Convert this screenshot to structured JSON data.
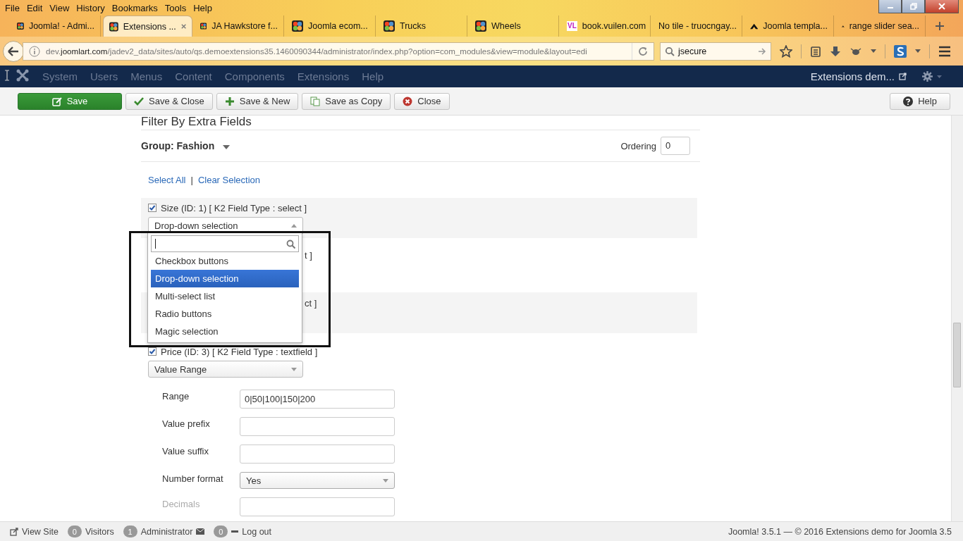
{
  "menu_bar": [
    "File",
    "Edit",
    "View",
    "History",
    "Bookmarks",
    "Tools",
    "Help"
  ],
  "browser_tabs": [
    {
      "title": "Joomla! - Admi...",
      "kind": "joomla",
      "selected": false
    },
    {
      "title": "Extensions ...",
      "kind": "joomla",
      "selected": true
    },
    {
      "title": "JA Hawkstore f...",
      "kind": "joomla",
      "selected": false
    },
    {
      "title": "Joomla ecom...",
      "kind": "joomla",
      "selected": false
    },
    {
      "title": "Trucks",
      "kind": "joomla",
      "selected": false
    },
    {
      "title": "Wheels",
      "kind": "joomla",
      "selected": false
    },
    {
      "title": "book.vuilen.com",
      "kind": "lettermark",
      "logo_text": "VL",
      "selected": false
    },
    {
      "title": "No tile - truocngay...",
      "kind": "plain",
      "selected": false
    },
    {
      "title": "Joomla templa...",
      "kind": "peak",
      "selected": false
    },
    {
      "title": "range slider sea...",
      "kind": "peak",
      "selected": false
    }
  ],
  "address_bar": {
    "url": "dev.**joomlart.com**/jadev2_data/sites/auto/qs.demoextensions35.1460090344/administrator/index.php?option=com_modules&view=module&layout=edi"
  },
  "search_box": {
    "value": "jsecure"
  },
  "admin_menu": {
    "items": [
      "System",
      "Users",
      "Menus",
      "Content",
      "Components",
      "Extensions",
      "Help"
    ],
    "site_link": "Extensions dem..."
  },
  "toolbar": {
    "buttons": [
      {
        "label": "Save",
        "kind": "primary"
      },
      {
        "label": "Save & Close",
        "kind": "default"
      },
      {
        "label": "Save & New",
        "kind": "default"
      },
      {
        "label": "Save as Copy",
        "kind": "default"
      },
      {
        "label": "Close",
        "kind": "default"
      }
    ],
    "help": "Help"
  },
  "section_title": "Filter By Extra Fields",
  "group": {
    "label": "Group: Fashion",
    "ordering_label": "Ordering",
    "ordering_value": "0"
  },
  "select_links": {
    "items": [
      "Select All",
      "Clear Selection"
    ],
    "separator": "|"
  },
  "fields": [
    {
      "kind": "field",
      "label": "Size (ID: 1) [ K2 Field Type : select ]",
      "checked": true,
      "display": "Drop-down selection",
      "expanded": true
    },
    {
      "kind": "covered",
      "label": "t ]"
    },
    {
      "kind": "covered",
      "label": "ct ]"
    },
    {
      "kind": "field",
      "label": "Price (ID: 3) [ K2 Field Type : textfield ]",
      "checked": true,
      "display": "Value Range",
      "expanded": false
    }
  ],
  "dropdown_options": [
    {
      "label": "Checkbox buttons",
      "selected": false
    },
    {
      "label": "Drop-down selection",
      "selected": true
    },
    {
      "label": "Multi-select list",
      "selected": false
    },
    {
      "label": "Radio buttons",
      "selected": false
    },
    {
      "label": "Magic selection",
      "selected": false
    }
  ],
  "price_settings": [
    {
      "label": "Range",
      "kind": "text",
      "value": "0|50|100|150|200"
    },
    {
      "label": "Value prefix",
      "kind": "text"
    },
    {
      "label": "Value suffix",
      "kind": "text"
    },
    {
      "label": "Number format",
      "kind": "select",
      "value": "Yes"
    },
    {
      "label": "Decimals",
      "kind": "text"
    }
  ],
  "status_bar": {
    "view_site": "View Site",
    "visitors_count": "0",
    "visitors_label": "Visitors",
    "admins_count": "1",
    "admins_label": "Administrator",
    "messages_count": "0",
    "logout": "Log out",
    "copyright": "Joomla! 3.5.1 — © 2016 Extensions demo for Joomla 3.5"
  }
}
